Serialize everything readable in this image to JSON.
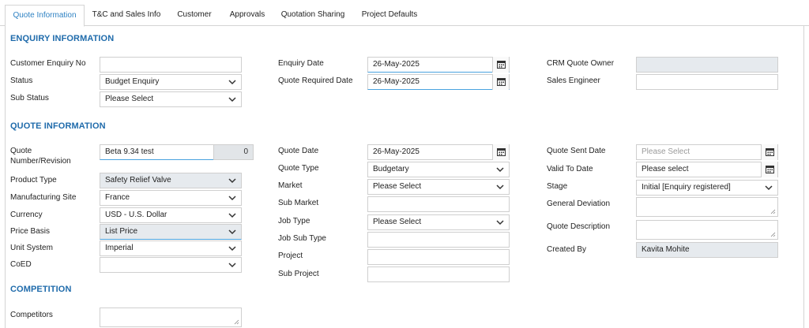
{
  "tabs": [
    {
      "label": "Quote Information",
      "active": true
    },
    {
      "label": "T&C and Sales Info"
    },
    {
      "label": "Customer"
    },
    {
      "label": "Approvals"
    },
    {
      "label": "Quotation Sharing"
    },
    {
      "label": "Project Defaults"
    }
  ],
  "enquiry": {
    "title": "ENQUIRY INFORMATION",
    "customer_enquiry_no": {
      "label": "Customer Enquiry No",
      "value": ""
    },
    "status": {
      "label": "Status",
      "value": "Budget Enquiry"
    },
    "sub_status": {
      "label": "Sub Status",
      "value": "Please Select"
    },
    "enquiry_date": {
      "label": "Enquiry Date",
      "value": "26-May-2025"
    },
    "quote_required_date": {
      "label": "Quote Required Date",
      "value": "26-May-2025"
    },
    "crm_quote_owner": {
      "label": "CRM Quote Owner",
      "value": ""
    },
    "sales_engineer": {
      "label": "Sales Engineer",
      "value": ""
    }
  },
  "quote": {
    "title": "QUOTE INFORMATION",
    "quote_number": {
      "label": "Quote Number/Revision",
      "value": "Beta 9.34 test",
      "revision": "0"
    },
    "product_type": {
      "label": "Product Type",
      "value": "Safety Relief Valve"
    },
    "manufacturing_site": {
      "label": "Manufacturing Site",
      "value": "France"
    },
    "currency": {
      "label": "Currency",
      "value": "USD - U.S. Dollar"
    },
    "price_basis": {
      "label": "Price Basis",
      "value": "List Price"
    },
    "unit_system": {
      "label": "Unit System",
      "value": "Imperial"
    },
    "coed": {
      "label": "CoED",
      "value": ""
    },
    "quote_date": {
      "label": "Quote Date",
      "value": "26-May-2025"
    },
    "quote_type": {
      "label": "Quote Type",
      "value": "Budgetary"
    },
    "market": {
      "label": "Market",
      "value": "Please Select"
    },
    "sub_market": {
      "label": "Sub Market",
      "value": ""
    },
    "job_type": {
      "label": "Job Type",
      "value": "Please Select"
    },
    "job_sub_type": {
      "label": "Job Sub Type",
      "value": ""
    },
    "project": {
      "label": "Project",
      "value": ""
    },
    "sub_project": {
      "label": "Sub Project",
      "value": ""
    },
    "quote_sent_date": {
      "label": "Quote Sent Date",
      "placeholder": "Please Select"
    },
    "valid_to_date": {
      "label": "Valid To Date",
      "value": "Please select"
    },
    "stage": {
      "label": "Stage",
      "value": "Initial [Enquiry registered]"
    },
    "general_deviation": {
      "label": "General Deviation",
      "value": ""
    },
    "quote_description": {
      "label": "Quote Description",
      "value": ""
    },
    "created_by": {
      "label": "Created By",
      "value": "Kavita Mohite"
    }
  },
  "competition": {
    "title": "COMPETITION",
    "competitors": {
      "label": "Competitors",
      "value": ""
    }
  },
  "icons": {
    "dropdown": "chevron-down-icon",
    "date": "calendar-icon",
    "resize": "resize-handle-icon"
  },
  "colors": {
    "accent": "#2f82c3",
    "section_title": "#1f6bab",
    "readonly_bg": "#e6eaee",
    "focus_underline": "#4aa3df"
  }
}
